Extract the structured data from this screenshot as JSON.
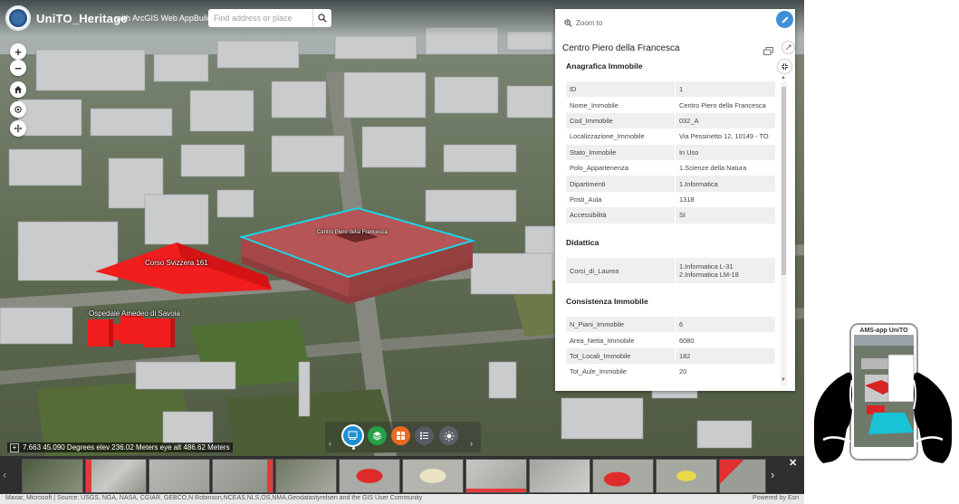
{
  "app": {
    "title": "UniTO_Heritage",
    "subtitle": "with ArcGIS Web AppBuilder"
  },
  "search": {
    "placeholder": "Find address or place",
    "value": ""
  },
  "map_tools": {
    "zoom_in": "+",
    "zoom_out": "−"
  },
  "scene_labels": {
    "main_building": "Centro Piero della Francesca",
    "triangle_building": "Corso Svizzera 161",
    "hospital_building": "Ospedale Amedeo di Savoia"
  },
  "popup": {
    "zoom_to": "Zoom to",
    "title": "Centro Piero della Francesca",
    "sections": [
      {
        "title": "Anagrafica Immobile",
        "rows": [
          {
            "key": "ID",
            "value": "1"
          },
          {
            "key": "Nome_Immobile",
            "value": "Centro Piero della Francesca"
          },
          {
            "key": "Cod_Immobile",
            "value": "032_A"
          },
          {
            "key": "Localizzazione_Immobile",
            "value": "Via Pessinetto 12, 10149 - TO"
          },
          {
            "key": "Stato_Immobile",
            "value": "In Uso"
          },
          {
            "key": "Polo_Appartenenza",
            "value": "1.Scienze della Natura"
          },
          {
            "key": "Dipartimenti",
            "value": "1.Informatica"
          },
          {
            "key": "Posti_Aula",
            "value": "1318"
          },
          {
            "key": "Accessibilità",
            "value": "SI"
          }
        ]
      },
      {
        "title": "Didattica",
        "rows": [
          {
            "key": "Corsi_di_Laurea",
            "value_lines": [
              "1.Informatica L-31",
              "2.Informatica LM-18"
            ]
          }
        ]
      },
      {
        "title": "Consistenza Immobile",
        "rows": [
          {
            "key": "N_Piani_Immobile",
            "value": "6"
          },
          {
            "key": "Area_Netta_Immobile",
            "value": "6080"
          },
          {
            "key": "Tot_Locali_Immobile",
            "value": "182"
          },
          {
            "key": "Tot_Aule_Immobile",
            "value": "20"
          }
        ]
      }
    ]
  },
  "coordinates": {
    "text": "7.663 45.090 Degrees  elev 236.02 Meters  eye alt 486.62 Meters"
  },
  "attribution": {
    "sources": "Maxar, Microsoft | Source: USGS, NGA, NASA, CGIAR, GEBCO,N Robinson,NCEAS,NLS,OS,NMA,Geodatastyrelsen and the GIS User Community",
    "powered_by": "Powered by Esri"
  },
  "phone": {
    "screen_title": "AMS-app UniTO"
  },
  "colors": {
    "highlight_cyan": "#19d6e6",
    "feature_red": "#f21d1d",
    "selected_building": "#b65555",
    "widget_blue": "#1f8fd6",
    "widget_green": "#24a148",
    "widget_orange": "#ea6a1e",
    "edit_blue": "#3d8fd6"
  },
  "icons": [
    "search-icon",
    "zoom-in-icon",
    "zoom-out-icon",
    "home-icon",
    "locate-icon",
    "navigate-icon",
    "zoom-to-icon",
    "edit-icon",
    "dock-icon",
    "float-icon",
    "collapse-icon",
    "basemap-gallery-icon",
    "layers-icon",
    "widgets-icon",
    "legend-icon",
    "daylight-icon",
    "close-icon"
  ]
}
